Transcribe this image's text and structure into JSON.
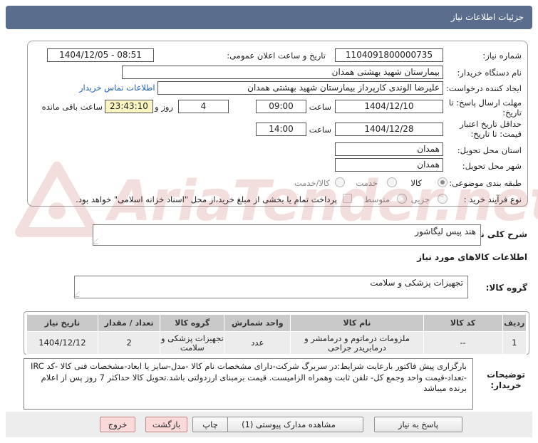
{
  "header": {
    "title": "جزئیات اطلاعات نیاز"
  },
  "form": {
    "need_number": {
      "label": "شماره نیاز:",
      "value": "1104091800000735"
    },
    "announce": {
      "label": "تاریخ و ساعت اعلان عمومی:",
      "value": "1404/12/05 - 08:51"
    },
    "buyer": {
      "label": "نام دستگاه خریدار:",
      "value": "بیمارستان شهید بهشتی همدان"
    },
    "creator": {
      "label": "ایجاد کننده درخواست:",
      "value": "علیرضا الوندی کارپرداز بیمارستان شهید بهشتی همدان",
      "contact_link": "اطلاعات تماس خریدار"
    },
    "deadline": {
      "label_line1": "مهلت ارسال پاسخ: تا",
      "label_line2": "تاریخ:",
      "date": "1404/12/10",
      "time_label": "ساعت",
      "time": "09:00",
      "days": "4",
      "days_label": "روز و",
      "remaining": "23:43:10",
      "remaining_label": "ساعت باقی مانده"
    },
    "validity": {
      "label_line1": "حداقل تاریخ اعتبار",
      "label_line2": "قیمت: تا تاریخ:",
      "date": "1404/12/28",
      "time_label": "ساعت",
      "time": "14:00"
    },
    "province": {
      "label": "استان محل تحویل:",
      "value": "همدان"
    },
    "city": {
      "label": "شهر محل تحویل:",
      "value": "همدان"
    },
    "category": {
      "label": "طبقه بندی موضوعی:",
      "options": [
        "کالا",
        "خدمت",
        "کالا/خدمت"
      ],
      "selected": "کالا"
    },
    "process": {
      "label": "نوع فرآیند خرید :",
      "options": [
        "جزیی",
        "متوسط"
      ],
      "payment_note": "پرداخت تمام یا بخشی از مبلغ خرید،از محل \"اسناد خزانه اسلامی\" خواهد بود."
    }
  },
  "summary": {
    "label": "شرح کلی نیاز:",
    "value": "هند پیس لیگاشور"
  },
  "goods_info": {
    "heading": "اطلاعات کالاهای مورد نیاز"
  },
  "goods_group": {
    "label": "گروه کالا:",
    "value": "تجهیزات پزشکی و سلامت"
  },
  "table": {
    "headers": [
      "ردیف",
      "کد کالا",
      "نام کالا",
      "واحد شمارش",
      "گروه کالا",
      "تعداد / مقدار",
      "تاریخ نیاز"
    ],
    "rows": [
      [
        "1",
        "--",
        "ملزومات درماتوم و درمامشر و درمابریدر جراحی",
        "عدد",
        "تجهیزات پزشکی و سلامت",
        "2",
        "1404/12/12"
      ]
    ]
  },
  "buyer_notes": {
    "label": "توضیحات خریدار:",
    "text": "بارگزاری پیش فاکتور بارعایت شرایط:در سربرگ شرکت-دارای مشخصات نام کالا -مدل-سایز یا ابعاد-مشخصات فنی کالا -کد IRC -تعداد-قیمت واحد وجمع کل- تلفن ثابت وهمراه الزامیست. قیمت برمبنای ارزدولتی باشد.تحویل کالا حداکثر 7 روز پس از اعلام برنده میباشد"
  },
  "buttons": {
    "reply": "پاسخ به نیاز",
    "attachments": "مشاهده مدارک پیوستی (1)",
    "print": "چاپ",
    "back": "بازگشت",
    "exit": "خروج"
  }
}
